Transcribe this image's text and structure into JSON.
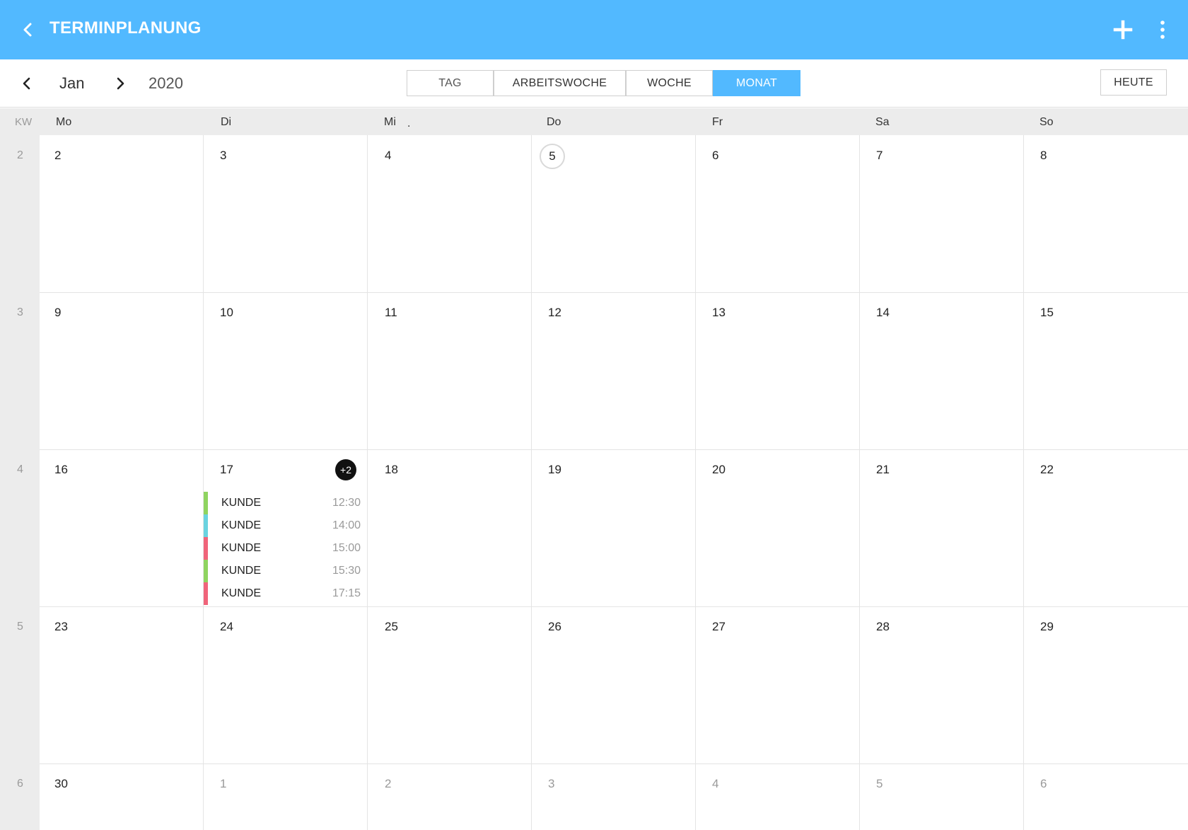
{
  "appbar": {
    "title": "TERMINPLANUNG",
    "icons": [
      "back-arrow-icon",
      "plus-icon",
      "more-vertical-icon"
    ]
  },
  "toolbar": {
    "month": "Jan",
    "year": "2020",
    "views": [
      "TAG",
      "ARBEITSWOCHE",
      "WOCHE",
      "MONAT"
    ],
    "active_view": "MONAT",
    "today_button": "HEUTE"
  },
  "calendar": {
    "kw_header": "KW",
    "weekdays": [
      "Mo",
      "Di",
      "Mi",
      "Do",
      "Fr",
      "Sa",
      "So"
    ],
    "weeks": [
      {
        "kw": "2",
        "days": [
          "2",
          "3",
          "4",
          "5",
          "6",
          "7",
          "8"
        ]
      },
      {
        "kw": "3",
        "days": [
          "9",
          "10",
          "11",
          "12",
          "13",
          "14",
          "15"
        ]
      },
      {
        "kw": "4",
        "days": [
          "16",
          "17",
          "18",
          "19",
          "20",
          "21",
          "22"
        ]
      },
      {
        "kw": "5",
        "days": [
          "23",
          "24",
          "25",
          "26",
          "27",
          "28",
          "29"
        ]
      },
      {
        "kw": "6",
        "days": [
          "30",
          "1",
          "2",
          "3",
          "4",
          "5",
          "6"
        ]
      }
    ],
    "today": "5",
    "more_badge": "+2",
    "events": [
      {
        "name": "KUNDE",
        "time": "12:30",
        "color": "#8fd460"
      },
      {
        "name": "KUNDE",
        "time": "14:00",
        "color": "#6ad3e0"
      },
      {
        "name": "KUNDE",
        "time": "15:00",
        "color": "#f0647a"
      },
      {
        "name": "KUNDE",
        "time": "15:30",
        "color": "#8fd460"
      },
      {
        "name": "KUNDE",
        "time": "17:15",
        "color": "#f0647a"
      }
    ]
  },
  "colors": {
    "accent": "#52b9ff",
    "header_bg": "#ececec"
  }
}
